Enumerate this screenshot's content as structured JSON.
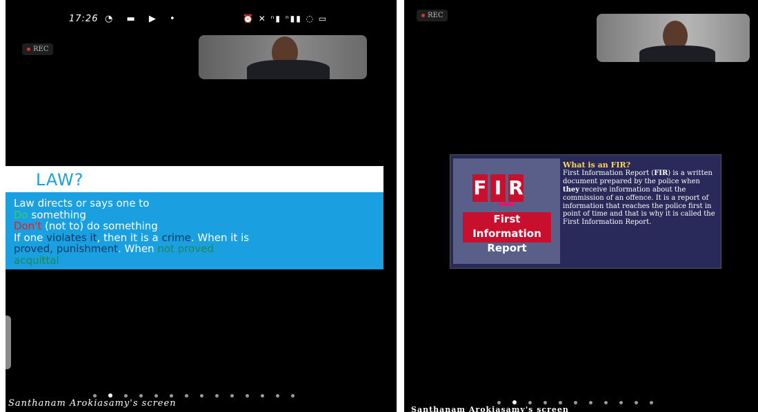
{
  "left": {
    "statusbar": {
      "time": "17:26",
      "icons_left": "◔ ▬ ▶ •",
      "icons_right": "⏰ ✕ ⁿ▮ ⁿ▮▮ ◌ ▭"
    },
    "rec_label": "REC",
    "slide": {
      "title": "LAW?",
      "line1": "Law directs or says one to",
      "line2_a": "Do",
      "line2_b": " something",
      "line3_a": "Don't",
      "line3_b": " (not to) do something",
      "line4_a": "If one ",
      "line4_b": "violates it",
      "line4_c": ", then it is a ",
      "line4_d": "crime",
      "line4_e": ". When it is",
      "line5_a": "proved, punishment",
      "line5_b": ". When ",
      "line5_c": "not proved",
      "line6": "acquittal"
    },
    "caption": "Santhanam Arokiasamy's screen"
  },
  "right": {
    "rec_label": "REC",
    "slide": {
      "logo_letters": [
        "F",
        "I",
        "R"
      ],
      "logo_line1": "First Information",
      "logo_line2": "Report",
      "question": "What is an FIR?",
      "p_a": "First Information Report (",
      "p_b": "FIR",
      "p_c": ") is a written document prepared by the police when ",
      "p_d": "they",
      "p_e": " receive information about the commission of an offence. It is a report of information that reaches the police first in point of time and that is why it is called the First Information Report."
    },
    "caption": "Santhanam Arokiasamy's screen"
  },
  "colors": {
    "slide_blue": "#1aa0e0",
    "fir_red": "#c8102e",
    "fir_bg": "#2a2a5a",
    "accent_green": "#2ad36b",
    "accent_red": "#e02020"
  }
}
